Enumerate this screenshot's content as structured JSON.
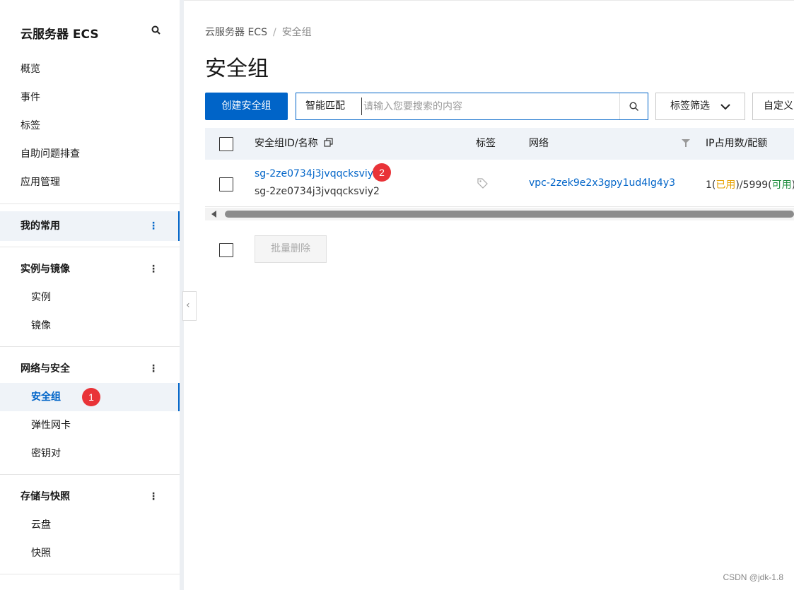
{
  "sidebar": {
    "title": "云服务器 ECS",
    "top_items": [
      "概览",
      "事件",
      "标签",
      "自助问题排查",
      "应用管理"
    ],
    "favorites": "我的常用",
    "sections": [
      {
        "label": "实例与镜像",
        "items": [
          "实例",
          "镜像"
        ]
      },
      {
        "label": "网络与安全",
        "items": [
          "安全组",
          "弹性网卡",
          "密钥对"
        ]
      },
      {
        "label": "存储与快照",
        "items": [
          "云盘",
          "快照"
        ]
      }
    ],
    "more_icon": "⋮",
    "collapse_icon": "‹"
  },
  "badges": {
    "first": "1",
    "second": "2"
  },
  "breadcrumb": {
    "root": "云服务器 ECS",
    "separator": "/",
    "current": "安全组"
  },
  "page_title": "安全组",
  "toolbar": {
    "create_label": "创建安全组",
    "search_type": "智能匹配",
    "search_placeholder": "请输入您要搜索的内容",
    "tag_filter_label": "标签筛选",
    "custom_label": "自定义"
  },
  "table": {
    "headers": {
      "id_name": "安全组ID/名称",
      "tag": "标签",
      "network": "网络",
      "ip": "IP占用数/配额"
    },
    "rows": [
      {
        "id": "sg-2ze0734j3jvqqcksviy2",
        "name": "sg-2ze0734j3jvqqcksviy2",
        "network": "vpc-2zek9e2x3gpy1ud4lg4y3",
        "ip_used_prefix": "1(",
        "ip_used_label": "已用",
        "ip_mid": ")/5999(",
        "ip_avail_label": "可用",
        "ip_suffix": ")"
      }
    ]
  },
  "batch_delete_label": "批量删除",
  "watermark": "CSDN @jdk-1.8",
  "colors": {
    "accent": "#0064c8",
    "badge": "#e93338",
    "brand": "#ff6a00"
  }
}
